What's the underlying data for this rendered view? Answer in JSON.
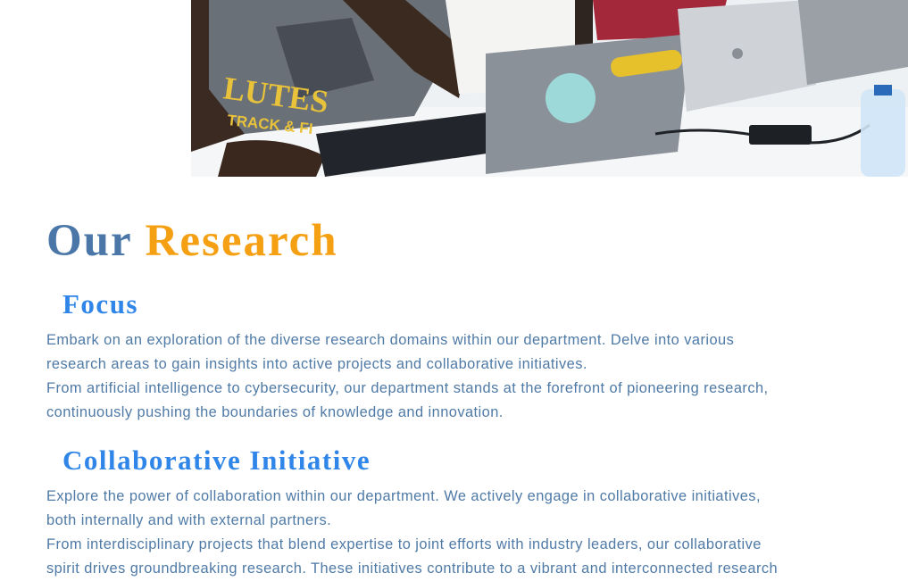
{
  "hero": {
    "image_alt": "Students working on laptops"
  },
  "heading": {
    "part1": "Our",
    "part2": "Research"
  },
  "sections": [
    {
      "title": "Focus",
      "lines": [
        "Embark on an exploration of the diverse research domains within our department. Delve into various",
        "research areas to gain insights into active projects and collaborative initiatives.",
        "From artificial intelligence to cybersecurity, our department stands at the forefront of pioneering research,",
        "continuously pushing the boundaries of knowledge and innovation."
      ]
    },
    {
      "title": "Collaborative Initiative",
      "lines": [
        "Explore the power of collaboration within our department. We actively engage in collaborative initiatives,",
        "both internally and with external partners.",
        "From interdisciplinary projects that blend expertise to joint efforts with industry leaders, our collaborative",
        "spirit drives groundbreaking research. These initiatives contribute to a vibrant and interconnected research"
      ]
    }
  ],
  "colors": {
    "heading_primary": "#4a76a8",
    "heading_accent": "#f4a012",
    "subheading": "#2f86e8",
    "body_text": "#4f7aa6"
  }
}
